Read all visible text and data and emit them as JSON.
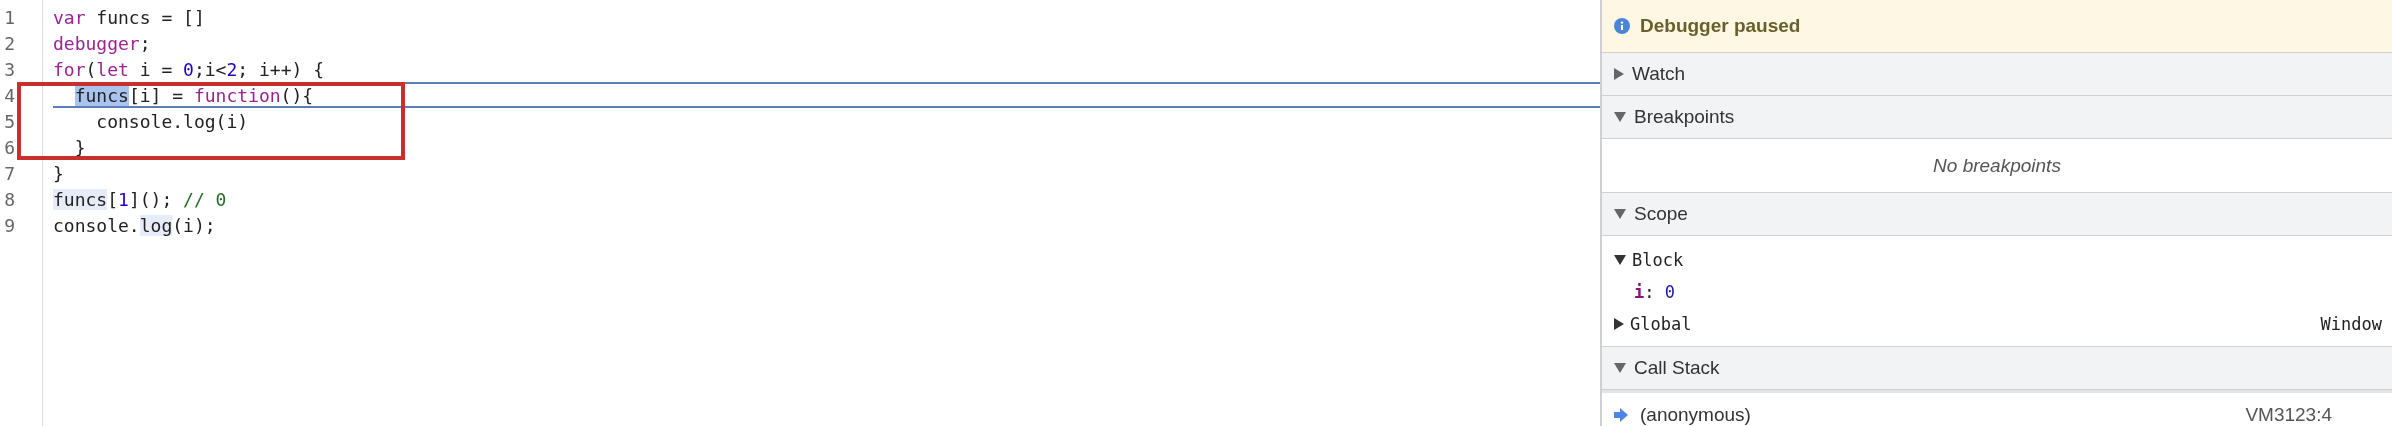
{
  "editor": {
    "lines": [
      {
        "number": "1",
        "paused": false,
        "boxed": false,
        "tokens": [
          {
            "text": "var",
            "kind": "keyword"
          },
          {
            "text": " funcs = []",
            "kind": "plain"
          }
        ]
      },
      {
        "number": "2",
        "paused": false,
        "boxed": false,
        "tokens": [
          {
            "text": "debugger",
            "kind": "keyword"
          },
          {
            "text": ";",
            "kind": "plain"
          }
        ]
      },
      {
        "number": "3",
        "paused": false,
        "boxed": false,
        "tokens": [
          {
            "text": "for",
            "kind": "keyword"
          },
          {
            "text": "(",
            "kind": "plain"
          },
          {
            "text": "let",
            "kind": "keyword"
          },
          {
            "text": " i = ",
            "kind": "plain"
          },
          {
            "text": "0",
            "kind": "number"
          },
          {
            "text": ";i<",
            "kind": "plain"
          },
          {
            "text": "2",
            "kind": "number"
          },
          {
            "text": "; i++) {",
            "kind": "plain"
          }
        ]
      },
      {
        "number": "4",
        "paused": true,
        "boxed": true,
        "tokens": [
          {
            "text": "  funcs",
            "kind": "plain",
            "color": "#a8c4ee"
          },
          {
            "text": "[i] = ",
            "kind": "plain"
          },
          {
            "text": "function",
            "kind": "keyword"
          },
          {
            "text": "(){",
            "kind": "plain"
          }
        ]
      },
      {
        "number": "5",
        "paused": false,
        "boxed": true,
        "tokens": [
          {
            "text": "    console.log(i)",
            "kind": "plain"
          }
        ]
      },
      {
        "number": "6",
        "paused": false,
        "boxed": true,
        "tokens": [
          {
            "text": "  }",
            "kind": "plain"
          }
        ]
      },
      {
        "number": "7",
        "paused": false,
        "boxed": false,
        "tokens": [
          {
            "text": "}",
            "kind": "plain"
          }
        ]
      },
      {
        "number": "8",
        "paused": false,
        "boxed": false,
        "tokens": [
          {
            "text": "funcs",
            "kind": "plain",
            "color": "#e6edf8"
          },
          {
            "text": "[",
            "kind": "plain"
          },
          {
            "text": "1",
            "kind": "number"
          },
          {
            "text": "](); ",
            "kind": "plain"
          },
          {
            "text": "// 0",
            "kind": "comment"
          }
        ]
      },
      {
        "number": "9",
        "paused": false,
        "boxed": false,
        "tokens": [
          {
            "text": "console.",
            "kind": "plain"
          },
          {
            "text": "log",
            "kind": "plain",
            "color": "#e6edf8"
          },
          {
            "text": "(i);",
            "kind": "plain"
          }
        ]
      }
    ]
  },
  "banner": {
    "text": "Debugger paused"
  },
  "sections": [
    {
      "title": "Watch",
      "expanded": false
    },
    {
      "title": "Breakpoints",
      "expanded": true,
      "empty_message": "No breakpoints"
    },
    {
      "title": "Scope",
      "expanded": true,
      "scopes": [
        {
          "name": "Block",
          "expanded": true,
          "variables": [
            {
              "name": "i",
              "separator": ":",
              "value": "0"
            }
          ]
        },
        {
          "name": "Global",
          "expanded": false,
          "value": "Window"
        }
      ]
    },
    {
      "title": "Call Stack",
      "expanded": true,
      "frames": [
        {
          "name": "(anonymous)",
          "location": "VM3123:4",
          "current": true
        }
      ]
    }
  ]
}
